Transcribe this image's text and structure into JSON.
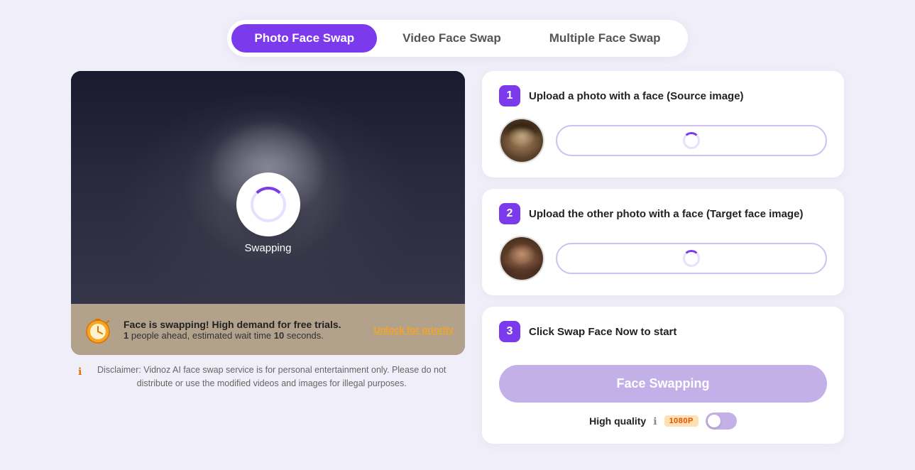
{
  "tabs": {
    "active": "photo",
    "items": [
      {
        "id": "photo",
        "label": "Photo Face Swap"
      },
      {
        "id": "video",
        "label": "Video Face Swap"
      },
      {
        "id": "multiple",
        "label": "Multiple Face Swap"
      }
    ]
  },
  "preview": {
    "swapping_label": "Swapping"
  },
  "notification": {
    "bold_line": "Face is swapping! High demand for free trials.",
    "sub_line_prefix": "",
    "ahead_count": "1",
    "wait_label": "people ahead, estimated wait time",
    "wait_seconds": "10",
    "wait_suffix": "seconds.",
    "unlock_label": "Unlock for priority"
  },
  "disclaimer": {
    "text": "Disclaimer: Vidnoz AI face swap service is for personal entertainment only. Please do not distribute or use the modified videos and images for illegal purposes."
  },
  "steps": [
    {
      "number": "1",
      "title": "Upload a photo with a face (Source image)",
      "loading": true
    },
    {
      "number": "2",
      "title": "Upload the other photo with a face (Target face image)",
      "loading": true
    },
    {
      "number": "3",
      "title": "Click Swap Face Now to start",
      "button_label": "Face Swapping",
      "quality_label": "High quality",
      "quality_badge": "1080P"
    }
  ]
}
